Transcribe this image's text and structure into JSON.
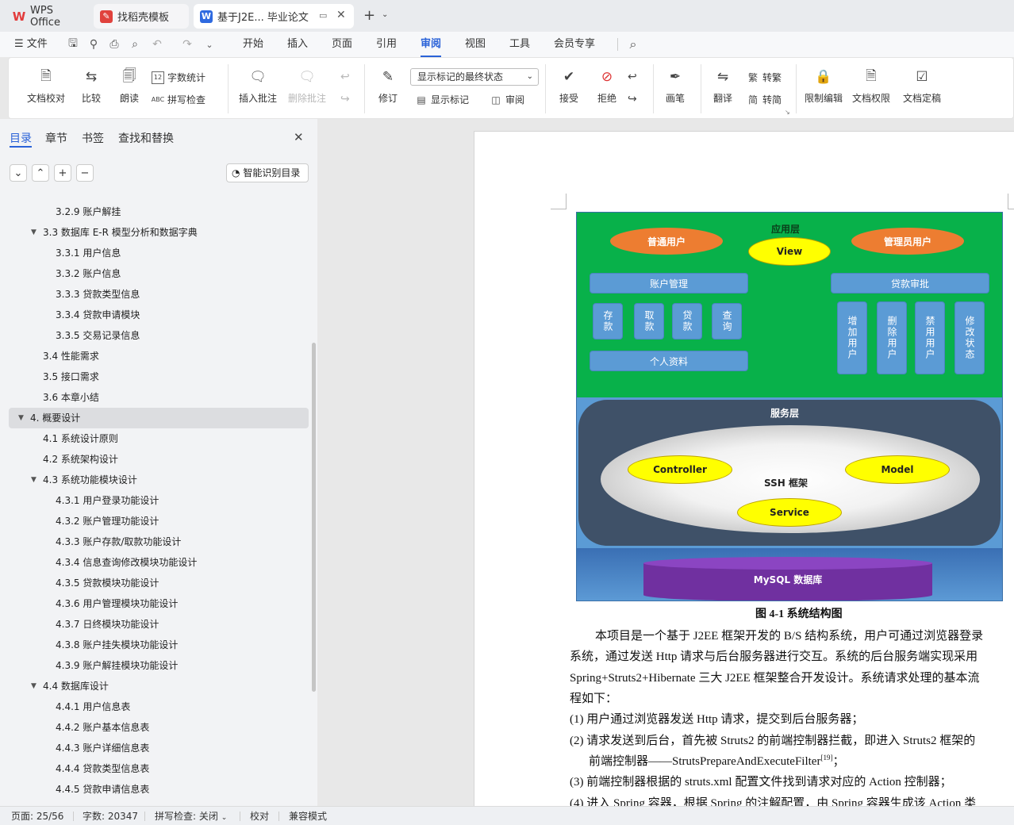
{
  "tabs": [
    {
      "label": "WPS Office",
      "icon": "wps-logo-icon"
    },
    {
      "label": "找稻壳模板",
      "icon": "docer-icon"
    },
    {
      "label": "基于J2E... 毕业论文",
      "icon": "word-doc-icon"
    }
  ],
  "menu": {
    "file": "文件",
    "items": [
      "开始",
      "插入",
      "页面",
      "引用",
      "审阅",
      "视图",
      "工具",
      "会员专享"
    ],
    "active": "审阅"
  },
  "ribbon": {
    "doc_check": "文档校对",
    "compare": "比较",
    "read_aloud": "朗读",
    "word_count": "字数统计",
    "spell_check": "拼写检查",
    "insert_comment": "插入批注",
    "delete_comment": "删除批注",
    "revise": "修订",
    "markup_select": "显示标记的最终状态",
    "show_markup": "显示标记",
    "review": "审阅",
    "accept": "接受",
    "reject": "拒绝",
    "ink": "画笔",
    "translate": "翻译",
    "to_traditional": "转繁",
    "to_simplified": "转简",
    "restrict_edit": "限制编辑",
    "doc_permission": "文档权限",
    "doc_finalize": "文档定稿"
  },
  "nav": {
    "tabs": [
      "目录",
      "章节",
      "书签",
      "查找和替换"
    ],
    "smart_toc": "智能识别目录",
    "toc": [
      {
        "label": "3.2.9  账户解挂",
        "level": 3,
        "toggle": ""
      },
      {
        "label": "3.3  数据库 E-R 模型分析和数据字典",
        "level": 2,
        "toggle": "▼"
      },
      {
        "label": "3.3.1  用户信息",
        "level": 3,
        "toggle": ""
      },
      {
        "label": "3.3.2  账户信息",
        "level": 3,
        "toggle": ""
      },
      {
        "label": "3.3.3  贷款类型信息",
        "level": 3,
        "toggle": ""
      },
      {
        "label": "3.3.4  贷款申请模块",
        "level": 3,
        "toggle": ""
      },
      {
        "label": "3.3.5  交易记录信息",
        "level": 3,
        "toggle": ""
      },
      {
        "label": "3.4  性能需求",
        "level": 2,
        "toggle": ""
      },
      {
        "label": "3.5  接口需求",
        "level": 2,
        "toggle": ""
      },
      {
        "label": "3.6  本章小结",
        "level": 2,
        "toggle": ""
      },
      {
        "label": "4.  概要设计",
        "level": 1,
        "toggle": "▼",
        "selected": true
      },
      {
        "label": "4.1  系统设计原则",
        "level": 2,
        "toggle": ""
      },
      {
        "label": "4.2 系统架构设计",
        "level": 2,
        "toggle": ""
      },
      {
        "label": "4.3  系统功能模块设计",
        "level": 2,
        "toggle": "▼"
      },
      {
        "label": "4.3.1  用户登录功能设计",
        "level": 3,
        "toggle": ""
      },
      {
        "label": "4.3.2  账户管理功能设计",
        "level": 3,
        "toggle": ""
      },
      {
        "label": "4.3.3  账户存款/取款功能设计",
        "level": 3,
        "toggle": ""
      },
      {
        "label": "4.3.4  信息查询修改模块功能设计",
        "level": 3,
        "toggle": ""
      },
      {
        "label": "4.3.5  贷款模块功能设计",
        "level": 3,
        "toggle": ""
      },
      {
        "label": "4.3.6  用户管理模块功能设计",
        "level": 3,
        "toggle": ""
      },
      {
        "label": "4.3.7  日终模块功能设计",
        "level": 3,
        "toggle": ""
      },
      {
        "label": "4.3.8  账户挂失模块功能设计",
        "level": 3,
        "toggle": ""
      },
      {
        "label": "4.3.9  账户解挂模块功能设计",
        "level": 3,
        "toggle": ""
      },
      {
        "label": "4.4  数据库设计",
        "level": 2,
        "toggle": "▼"
      },
      {
        "label": "4.4.1  用户信息表",
        "level": 3,
        "toggle": ""
      },
      {
        "label": "4.4.2  账户基本信息表",
        "level": 3,
        "toggle": ""
      },
      {
        "label": "4.4.3  账户详细信息表",
        "level": 3,
        "toggle": ""
      },
      {
        "label": "4.4.4  贷款类型信息表",
        "level": 3,
        "toggle": ""
      },
      {
        "label": "4.4.5  贷款申请信息表",
        "level": 3,
        "toggle": ""
      }
    ]
  },
  "diagram": {
    "app_layer": "应用层",
    "normal_user": "普通用户",
    "admin_user": "管理员用户",
    "view": "View",
    "account_mgmt": "账户管理",
    "loan_approval": "贷款审批",
    "deposit": "存款",
    "withdraw": "取款",
    "loan": "贷款",
    "query": "查询",
    "profile": "个人资料",
    "add_user": "增加用户",
    "delete_user": "删除用户",
    "disable_user": "禁用用户",
    "modify_state": "修改状态",
    "service_layer": "服务层",
    "controller": "Controller",
    "model": "Model",
    "ssh": "SSH 框架",
    "service": "Service",
    "mysql": "MySQL 数据库",
    "caption": "图 4-1  系统结构图"
  },
  "body": {
    "lines": [
      "本项目是一个基于 J2EE 框架开发的 B/S 结构系统，用户可通过浏览器登录",
      "系统，通过发送 Http 请求与后台服务器进行交互。系统的后台服务端实现采用",
      "Spring+Struts2+Hibernate 三大 J2EE 框架整合开发设计。系统请求处理的基本流",
      "程如下：",
      "(1) 用户通过浏览器发送 Http 请求，提交到后台服务器；",
      "(2) 请求发送到后台，首先被 Struts2 的前端控制器拦截，即进入 Struts2 框架的",
      "前端控制器——StrutsPrepareAndExecuteFilter",
      "(3) 前端控制器根据的 struts.xml 配置文件找到请求对应的 Action 控制器；",
      "(4) 进入 Spring 容器，根据 Spring 的注解配置，由 Spring 容器生成该 Action 类"
    ],
    "citation": "[19]",
    "citation_tail": "；"
  },
  "status": {
    "page": "页面: 25/56",
    "words": "字数: 20347",
    "spell": "拼写检查: 关闭",
    "proof": "校对",
    "compat": "兼容模式"
  }
}
